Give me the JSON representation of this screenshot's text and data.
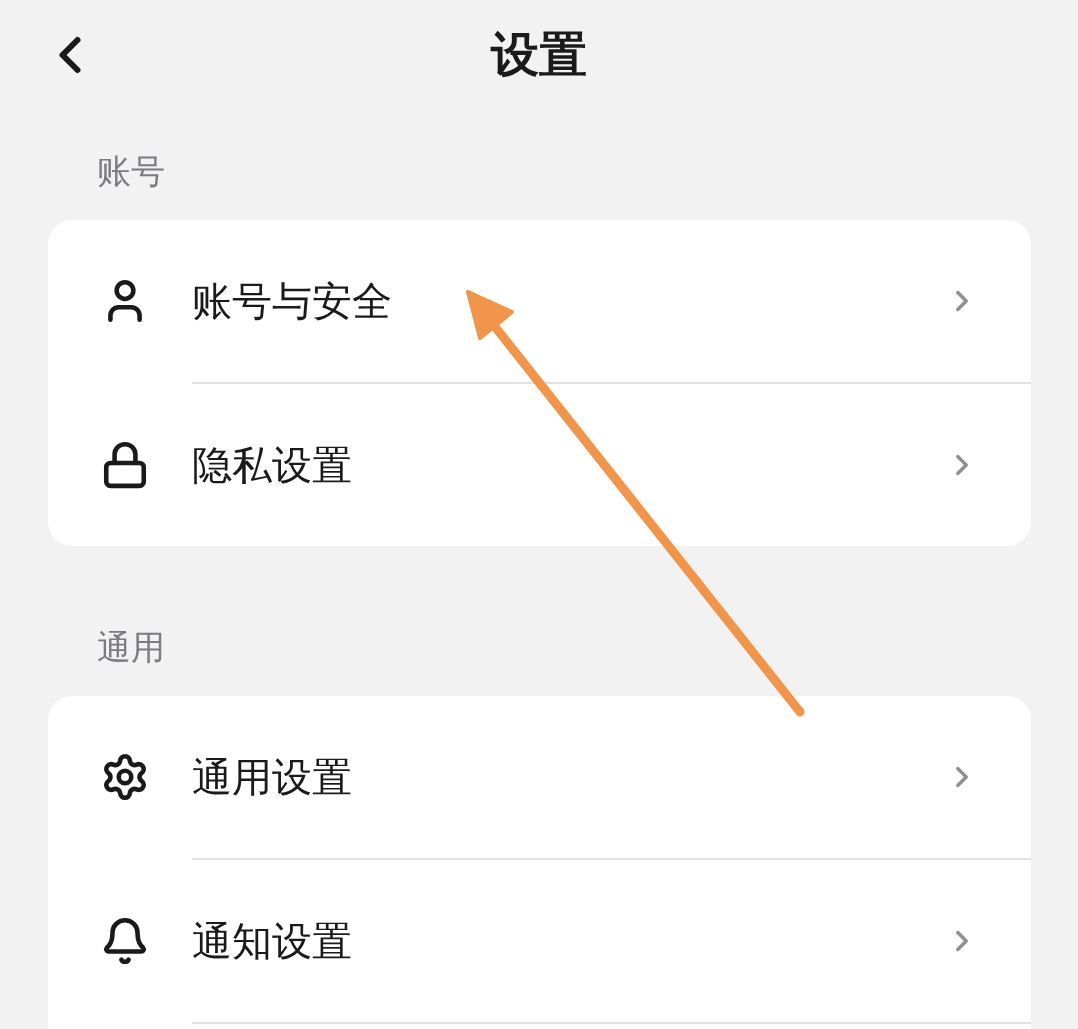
{
  "header": {
    "title": "设置"
  },
  "sections": [
    {
      "label": "账号",
      "continues": false,
      "items": [
        {
          "label": "账号与安全",
          "kind": "user"
        },
        {
          "label": "隐私设置",
          "kind": "lock"
        }
      ]
    },
    {
      "label": "通用",
      "continues": true,
      "items": [
        {
          "label": "通用设置",
          "kind": "gear"
        },
        {
          "label": "通知设置",
          "kind": "bell"
        }
      ]
    }
  ]
}
